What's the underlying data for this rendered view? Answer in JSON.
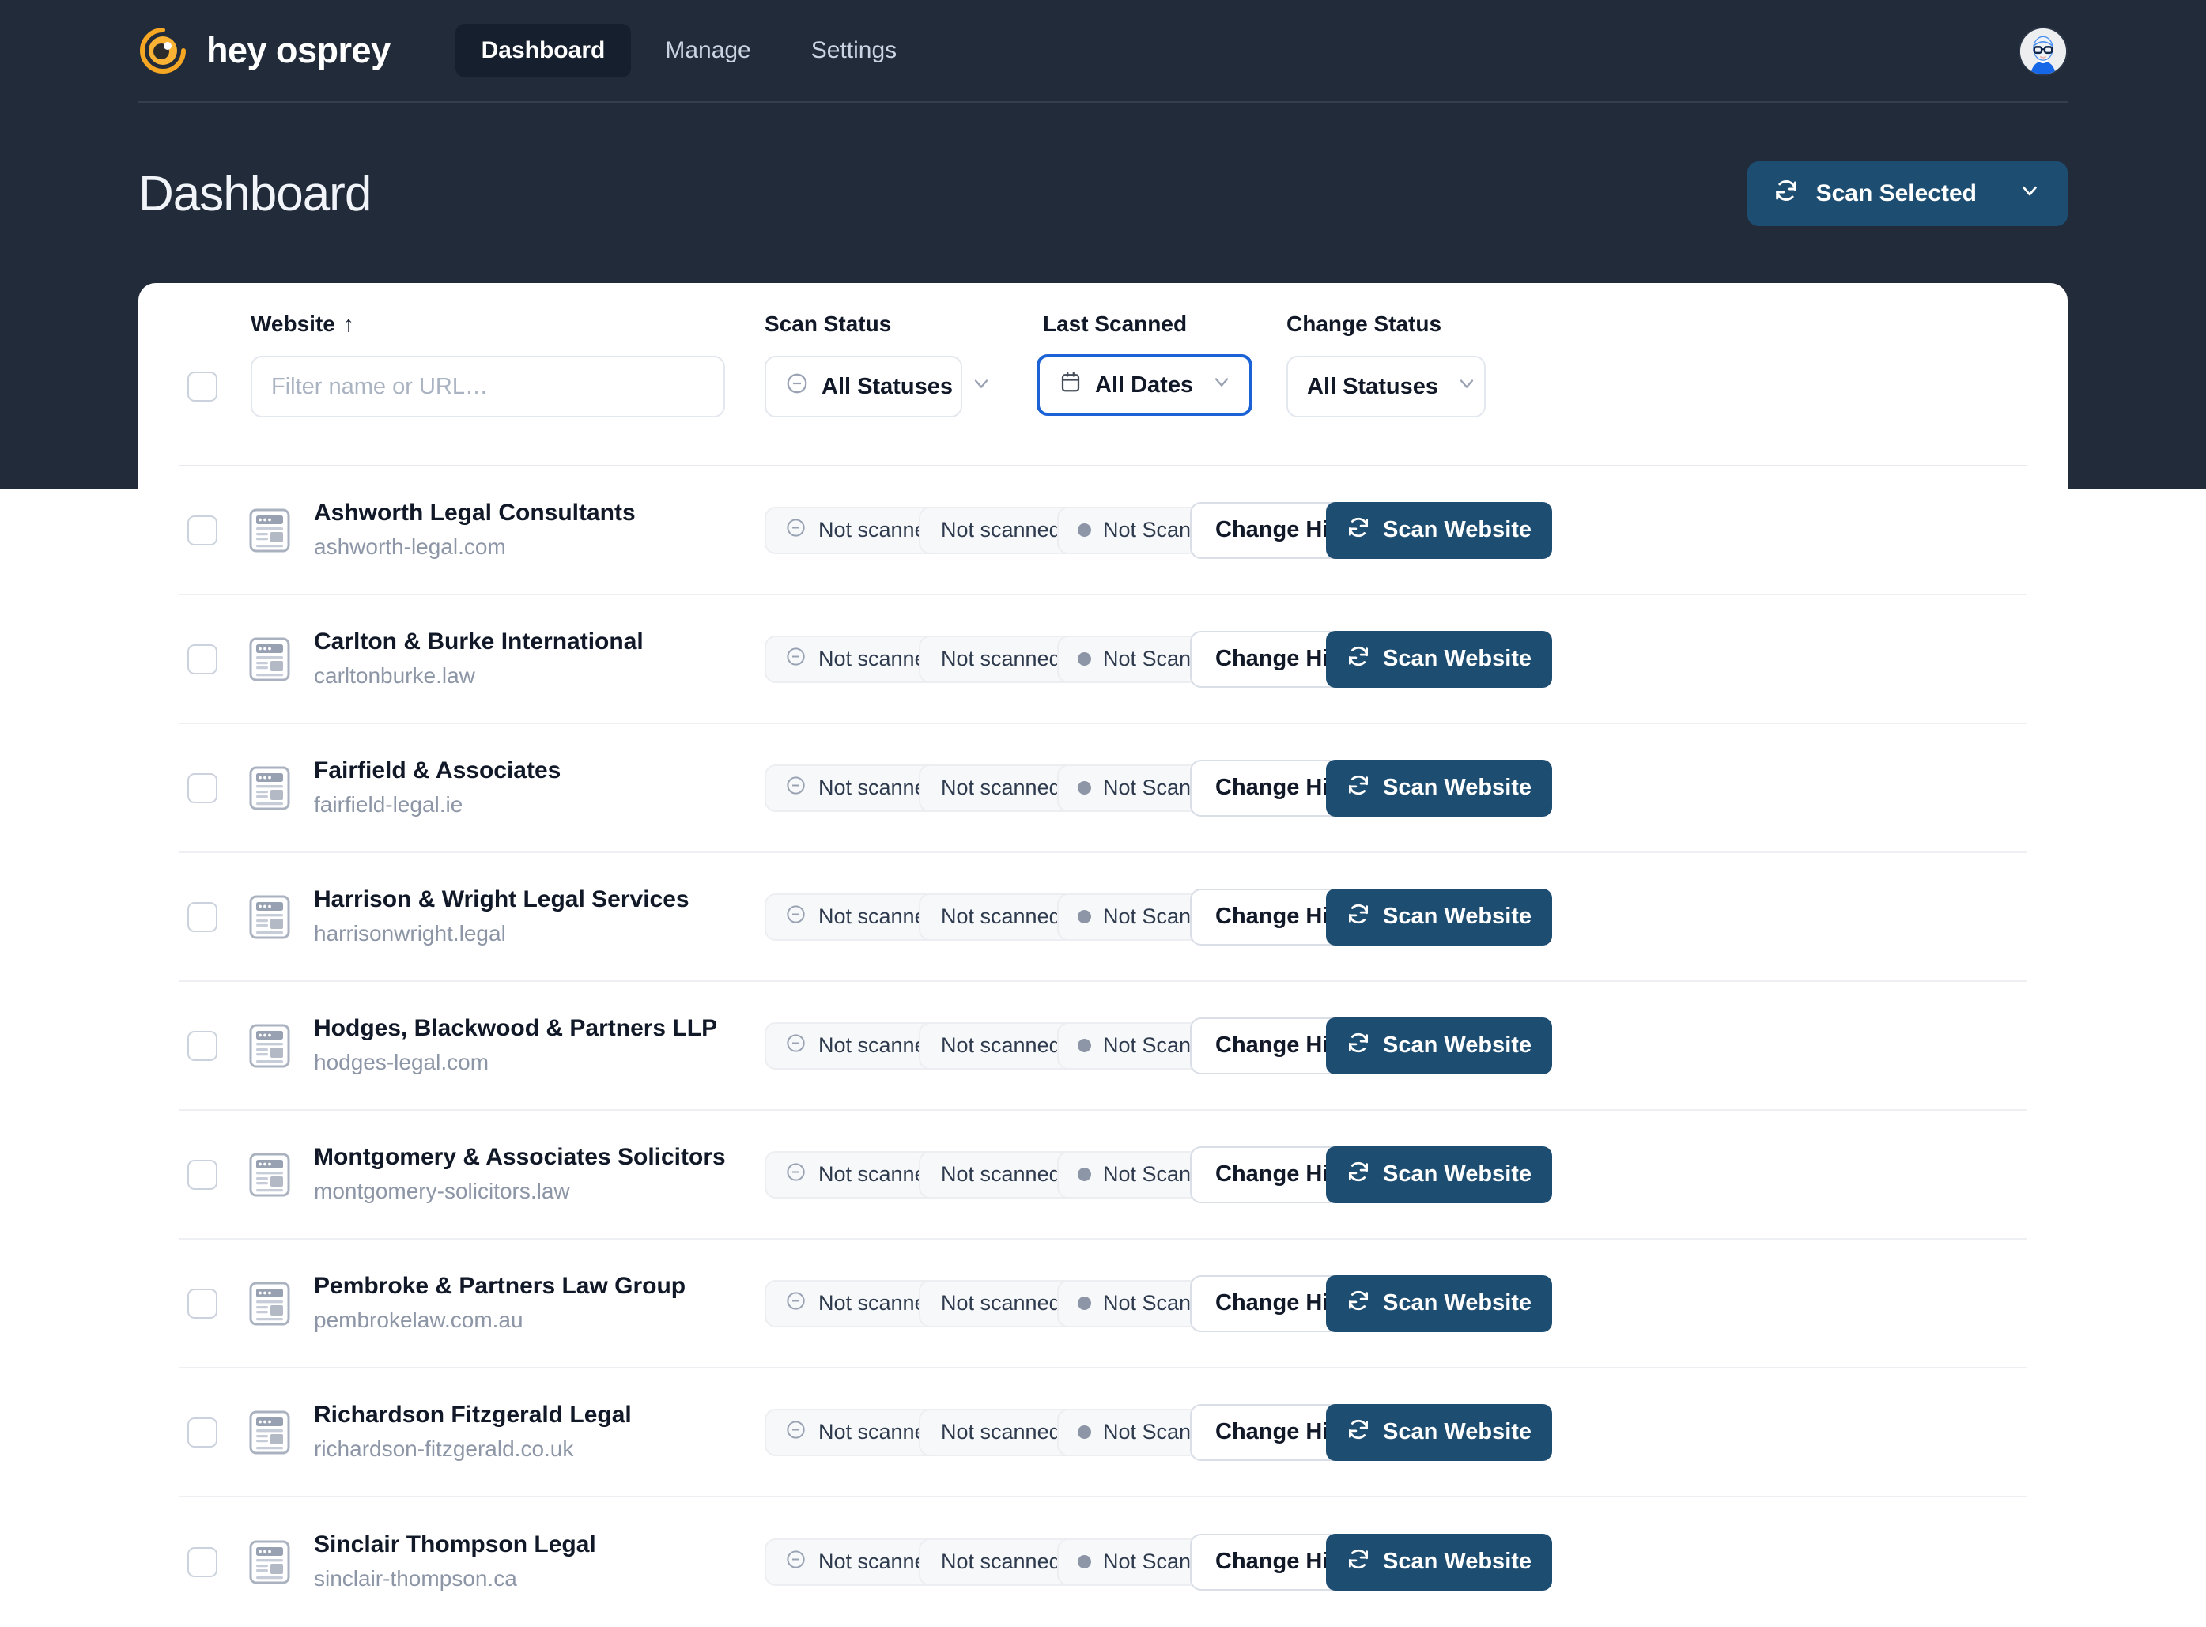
{
  "brand": {
    "name": "hey osprey",
    "logo_icon": "osprey-eye-logo",
    "accent": "#f5a623"
  },
  "nav": {
    "items": [
      {
        "label": "Dashboard",
        "active": true
      },
      {
        "label": "Manage",
        "active": false
      },
      {
        "label": "Settings",
        "active": false
      }
    ],
    "avatar_icon": "user-avatar"
  },
  "page": {
    "title": "Dashboard",
    "scan_selected": {
      "label": "Scan Selected",
      "icon": "refresh-icon",
      "caret": "chevron-down-icon"
    }
  },
  "colors": {
    "backdrop": "#212b3a",
    "nav_active_bg": "#161f2e",
    "primary_button": "#1d4d71",
    "focus_ring": "#1a62d6",
    "muted_text": "#8d96a6"
  },
  "table": {
    "columns": {
      "website": {
        "label": "Website",
        "sort": "↑"
      },
      "scan_status": {
        "label": "Scan Status"
      },
      "last_scanned": {
        "label": "Last Scanned"
      },
      "change_status": {
        "label": "Change Status"
      }
    },
    "filters": {
      "website": {
        "value": "",
        "placeholder": "Filter name or URL…"
      },
      "scan_status": {
        "value": "All Statuses",
        "icon": "minus-circle-icon",
        "caret": "chevron-down-icon",
        "focused": false
      },
      "last_scanned": {
        "value": "All Dates",
        "icon": "calendar-icon",
        "caret": "chevron-down-icon",
        "focused": true
      },
      "change_status": {
        "value": "All Statuses",
        "caret": "chevron-down-icon",
        "focused": false
      }
    },
    "actions": {
      "history_label": "Change History",
      "scan_label": "Scan Website",
      "scan_icon": "refresh-icon"
    },
    "rows": [
      {
        "name": "Ashworth Legal Consultants",
        "url": "ashworth-legal.com",
        "scan_status": "Not scanned",
        "last_scanned": "Not scanned",
        "change_status": "Not Scanned"
      },
      {
        "name": "Carlton & Burke International",
        "url": "carltonburke.law",
        "scan_status": "Not scanned",
        "last_scanned": "Not scanned",
        "change_status": "Not Scanned"
      },
      {
        "name": "Fairfield & Associates",
        "url": "fairfield-legal.ie",
        "scan_status": "Not scanned",
        "last_scanned": "Not scanned",
        "change_status": "Not Scanned"
      },
      {
        "name": "Harrison & Wright Legal Services",
        "url": "harrisonwright.legal",
        "scan_status": "Not scanned",
        "last_scanned": "Not scanned",
        "change_status": "Not Scanned"
      },
      {
        "name": "Hodges, Blackwood & Partners LLP",
        "url": "hodges-legal.com",
        "scan_status": "Not scanned",
        "last_scanned": "Not scanned",
        "change_status": "Not Scanned"
      },
      {
        "name": "Montgomery & Associates Solicitors",
        "url": "montgomery-solicitors.law",
        "scan_status": "Not scanned",
        "last_scanned": "Not scanned",
        "change_status": "Not Scanned"
      },
      {
        "name": "Pembroke & Partners Law Group",
        "url": "pembrokelaw.com.au",
        "scan_status": "Not scanned",
        "last_scanned": "Not scanned",
        "change_status": "Not Scanned"
      },
      {
        "name": "Richardson Fitzgerald Legal",
        "url": "richardson-fitzgerald.co.uk",
        "scan_status": "Not scanned",
        "last_scanned": "Not scanned",
        "change_status": "Not Scanned"
      },
      {
        "name": "Sinclair Thompson Legal",
        "url": "sinclair-thompson.ca",
        "scan_status": "Not scanned",
        "last_scanned": "Not scanned",
        "change_status": "Not Scanned"
      }
    ]
  }
}
